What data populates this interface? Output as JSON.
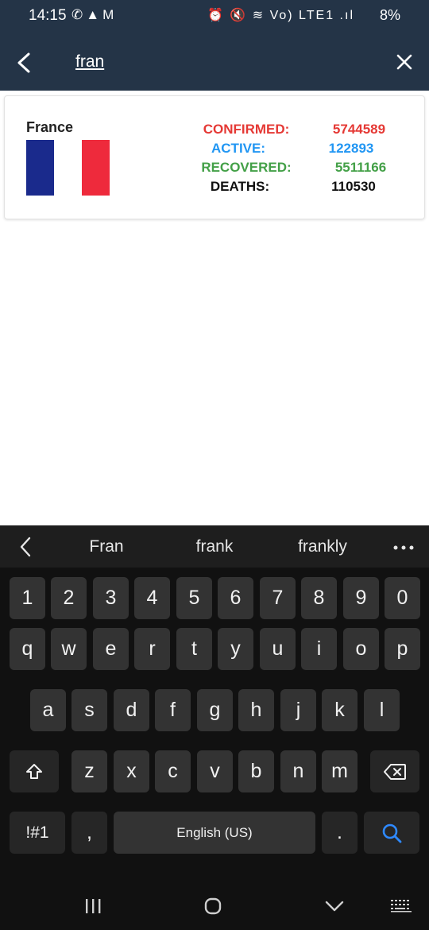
{
  "status_bar": {
    "time": "14:15",
    "left_icons": "✆▲M",
    "right_icons": "⏰ 🔇 ≋ Vo) LTE1 .ıl",
    "battery": "8%"
  },
  "app_bar": {
    "search_text": "fran",
    "back_icon": "chevron-left-icon",
    "clear_icon": "close-icon"
  },
  "result_card": {
    "country": "France",
    "flag_colors": [
      "#1a2a8c",
      "#ffffff",
      "#ee2a3c"
    ],
    "stats": [
      {
        "label": "CONFIRMED:",
        "value": "5744589",
        "color": "#e53935"
      },
      {
        "label": "ACTIVE:",
        "value": "122893",
        "color": "#2196f3"
      },
      {
        "label": "RECOVERED:",
        "value": "5511166",
        "color": "#43a047"
      },
      {
        "label": "DEATHS:",
        "value": "110530",
        "color": "#111111"
      }
    ]
  },
  "keyboard": {
    "suggestions": [
      "Fran",
      "frank",
      "frankly"
    ],
    "more_icon": "more-horizontal-icon",
    "row_numbers": [
      "1",
      "2",
      "3",
      "4",
      "5",
      "6",
      "7",
      "8",
      "9",
      "0"
    ],
    "row_q": [
      "q",
      "w",
      "e",
      "r",
      "t",
      "y",
      "u",
      "i",
      "o",
      "p"
    ],
    "row_a": [
      "a",
      "s",
      "d",
      "f",
      "g",
      "h",
      "j",
      "k",
      "l"
    ],
    "row_z": [
      "z",
      "x",
      "c",
      "v",
      "b",
      "n",
      "m"
    ],
    "symbols_label": "!#1",
    "comma_label": ",",
    "space_label": "English (US)",
    "period_label": "."
  },
  "colors": {
    "header_bg": "#243447",
    "keyboard_bg": "#111111",
    "key_bg": "#333333",
    "search_key": "#2e89ff"
  }
}
